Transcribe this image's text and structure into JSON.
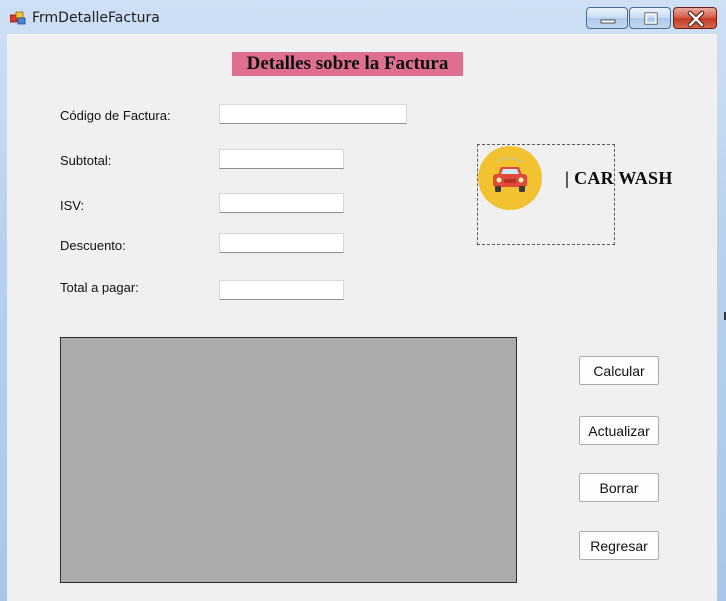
{
  "window": {
    "title": "FrmDetalleFactura"
  },
  "form": {
    "heading": "Detalles sobre la Factura",
    "labels": {
      "codigo": "Código de Factura:",
      "subtotal": "Subtotal:",
      "isv": "ISV:",
      "descuento": "Descuento:",
      "total": "Total a pagar:"
    },
    "values": {
      "codigo": "",
      "subtotal": "",
      "isv": "",
      "descuento": "",
      "total": ""
    }
  },
  "logo": {
    "brand_text": "| CAR WASH",
    "icon": "car-icon"
  },
  "buttons": {
    "calcular": "Calcular",
    "actualizar": "Actualizar",
    "borrar": "Borrar",
    "regresar": "Regresar"
  },
  "colors": {
    "heading_bg": "#df6f91",
    "grid_bg": "#ababab",
    "logo_circle": "#f2c230",
    "car": "#e14a3a"
  }
}
